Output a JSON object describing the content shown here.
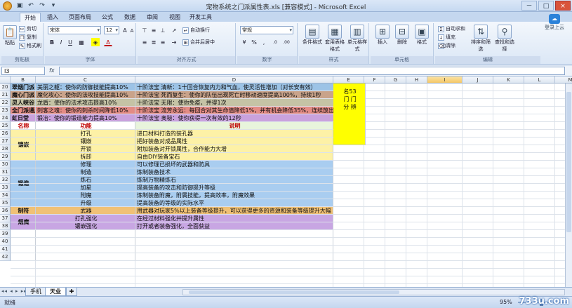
{
  "window": {
    "title": "宠物系统之门派属性表.xls [兼容模式] - Microsoft Excel",
    "qat_icons": [
      "save-icon",
      "undo-icon",
      "redo-icon",
      "qat-dropdown-icon"
    ],
    "controls": [
      "－",
      "□",
      "×"
    ]
  },
  "tabs": [
    {
      "label": "开始",
      "active": true
    },
    {
      "label": "插入"
    },
    {
      "label": "页面布局"
    },
    {
      "label": "公式"
    },
    {
      "label": "数据"
    },
    {
      "label": "审阅"
    },
    {
      "label": "视图"
    },
    {
      "label": "开发工具"
    }
  ],
  "cloud": {
    "label": "登录上云"
  },
  "ribbon": {
    "clipboard": {
      "label": "剪贴板",
      "paste": "粘贴",
      "cut": "剪切",
      "copy": "复制",
      "format_painter": "格式刷"
    },
    "font": {
      "label": "字体",
      "name": "宋体",
      "size": "12",
      "bold": "B",
      "italic": "I",
      "underline": "U",
      "grow": "A",
      "shrink": "A",
      "color": "A"
    },
    "alignment": {
      "label": "对齐方式",
      "wrap": "自动换行",
      "merge": "合并后居中"
    },
    "number": {
      "label": "数字",
      "format": "常规",
      "percent": "%",
      "comma": ",",
      "inc": ".0",
      "dec": ".00"
    },
    "styles": {
      "label": "样式",
      "conditional": "条件格式",
      "table": "套用表格格式",
      "cell_styles": "单元格样式"
    },
    "cells": {
      "label": "单元格",
      "insert": "插入",
      "delete": "删除",
      "format": "格式"
    },
    "editing": {
      "label": "编辑",
      "autosum": "自动求和",
      "fill": "填充",
      "clear": "清除",
      "sort": "排序和筛选",
      "find": "查找和选择"
    }
  },
  "formula_bar": {
    "name_box": "I3",
    "fx": "fx",
    "value": ""
  },
  "columns": [
    "B",
    "C",
    "D",
    "E",
    "F",
    "G",
    "H",
    "I",
    "J",
    "K",
    "L",
    "M",
    "N"
  ],
  "selected_column": "I",
  "rows": [
    {
      "num": "20",
      "b": "翠烟门派",
      "c": "美丽之躯：使你的防御技能提高10%",
      "d": "十阶法宝",
      "e": "清新：1十回合恢复内力和气血，使灵活性增加（对长安有效）",
      "color": "#9cc3e6"
    },
    {
      "num": "21",
      "b": "魔心门派",
      "c": "魔化攻心：使你的法攻技能提高10%",
      "d": "十阶法宝",
      "e": "死而复生：使你的队伍出现死亡时移动速度提高100%，持续1秒",
      "color": "#c9a38a"
    },
    {
      "num": "22",
      "b": "灵人峡谷",
      "c": "龙盾：使你的法术攻击提高10%",
      "d": "十阶法宝",
      "e": "无限：使你免疫，并得1次",
      "color": "#c5c3a5"
    },
    {
      "num": "23",
      "b": "全门派通用",
      "c": "刺客之魂：使你的刺杀时间降低10%",
      "d": "十阶法宝",
      "e": "流芳永远：每回合对其生命值降低1%，并有机会降低35%，连续放出效果",
      "color": "#e38b84"
    },
    {
      "num": "24",
      "b": "虹日堂",
      "c": "锻冶：使你的锻造能力提高10%",
      "d": "十阶法宝",
      "e": "奥秘：使你获得一次有效的12秒",
      "color": "#c9a2dd"
    }
  ],
  "header_row": {
    "num": "25",
    "b": "名称",
    "c": "功能",
    "d": "说明"
  },
  "side_note": {
    "lines": [
      "名53",
      "门 门",
      "分 辨"
    ]
  },
  "groups": [
    {
      "name": "镶嵌",
      "color": "#fdf1a6",
      "items": [
        {
          "num": "26",
          "c": "打孔",
          "d": "进口材料打造的装孔器"
        },
        {
          "num": "27",
          "c": "镶嵌",
          "d": "把好装备对成品属性"
        },
        {
          "num": "28",
          "c": "开锁",
          "d": "附加装备对开锁属性，合作能力大增"
        },
        {
          "num": "29",
          "c": "拆卸",
          "d": "自由DIY装备宝石"
        }
      ]
    },
    {
      "name": "锻造",
      "color": "#a9cdf0",
      "items": [
        {
          "num": "30",
          "c": "修理",
          "d": "可以修理已损坏的武器和防具"
        },
        {
          "num": "31",
          "c": "制造",
          "d": "炼制装备技术"
        },
        {
          "num": "32",
          "c": "炼石",
          "d": "炼制万物精炼石"
        },
        {
          "num": "33",
          "c": "加星",
          "d": "提高装备的攻击和防御提升等级"
        },
        {
          "num": "34",
          "c": "附魔",
          "d": "炼制装备附魔，附属技能，提高效率，附魔效果"
        },
        {
          "num": "35",
          "c": "升级",
          "d": "提高装备的等级的实际水平"
        }
      ]
    },
    {
      "name": "制符",
      "color": "#f0c176",
      "items": [
        {
          "num": "36",
          "c": "武器",
          "d": "用武器对玩家5%以上装备等级提升，可以获得更多的资源和装备等级提升大幅"
        }
      ]
    },
    {
      "name": "烟魔",
      "color": "#c8a6e3",
      "items": [
        {
          "num": "37",
          "c": "打孔强化",
          "d": "在经过材料强化并提升属性"
        },
        {
          "num": "38",
          "c": "镶嵌强化",
          "d": "打开或者装备强化，全面获益"
        }
      ]
    }
  ],
  "empty_rows": [
    "39",
    "40",
    "41",
    "42"
  ],
  "sheets": [
    {
      "label": "手机",
      "active": false
    },
    {
      "label": "天业",
      "active": true
    }
  ],
  "status": {
    "ready": "就绪",
    "zoom": "95%",
    "zoom_level": 0.47
  },
  "watermark": "733u.com"
}
